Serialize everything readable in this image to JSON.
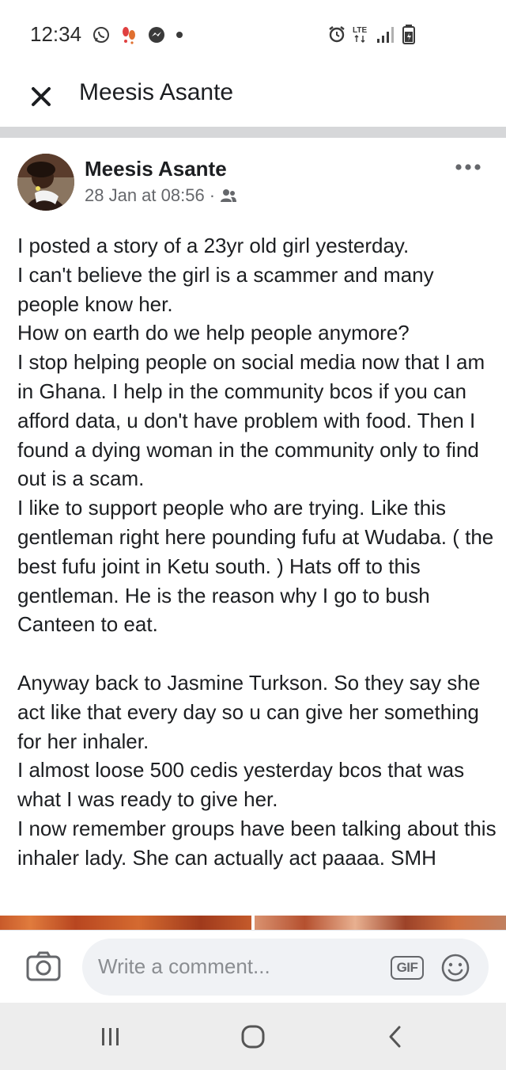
{
  "status_bar": {
    "time": "12:34",
    "left_icons": [
      "whatsapp-icon",
      "notification-icon",
      "messenger-icon",
      "dot-icon"
    ],
    "right_icons": [
      "alarm-icon",
      "lte-icon",
      "signal-icon",
      "battery-icon"
    ],
    "network_label": "LTE"
  },
  "header": {
    "title": "Meesis Asante",
    "close_icon": "close-icon"
  },
  "post": {
    "author": "Meesis Asante",
    "timestamp": "28 Jan at 08:56",
    "separator": "·",
    "audience_icon": "friends-icon",
    "more_icon": "more-options-icon",
    "body": "I posted a story of a 23yr old girl yesterday.\nI can't believe the girl is a scammer and many people know her.\nHow on earth do we help people anymore?\nI stop helping people on social media now that I am in Ghana.  I help in the community bcos if you can afford data, u don't have problem with food. Then I found a dying woman in the community only to find out is a scam.\nI like to support people who are trying. Like this gentleman right here pounding fufu at Wudaba. ( the best fufu joint in Ketu south. ) Hats off to this gentleman.  He is the reason why I go to bush Canteen to eat.\n\nAnyway back to Jasmine Turkson.  So they say she act like that every day so u can give her something for her inhaler.\nI almost loose 500 cedis yesterday bcos that was what I was ready to give her.\nI now remember groups have been talking about this inhaler lady. She can actually act paaaa. SMH"
  },
  "composer": {
    "placeholder": "Write a comment...",
    "gif_label": "GIF",
    "camera_icon": "camera-icon",
    "emoji_icon": "emoji-icon"
  },
  "nav_bar": {
    "recent_icon": "recent-apps-icon",
    "home_icon": "home-icon",
    "back_icon": "back-icon"
  },
  "colors": {
    "text_primary": "#1c1e21",
    "text_secondary": "#65676b",
    "divider": "#d6d7d9",
    "comment_bg": "#f0f2f5",
    "nav_bg": "#ededed"
  }
}
